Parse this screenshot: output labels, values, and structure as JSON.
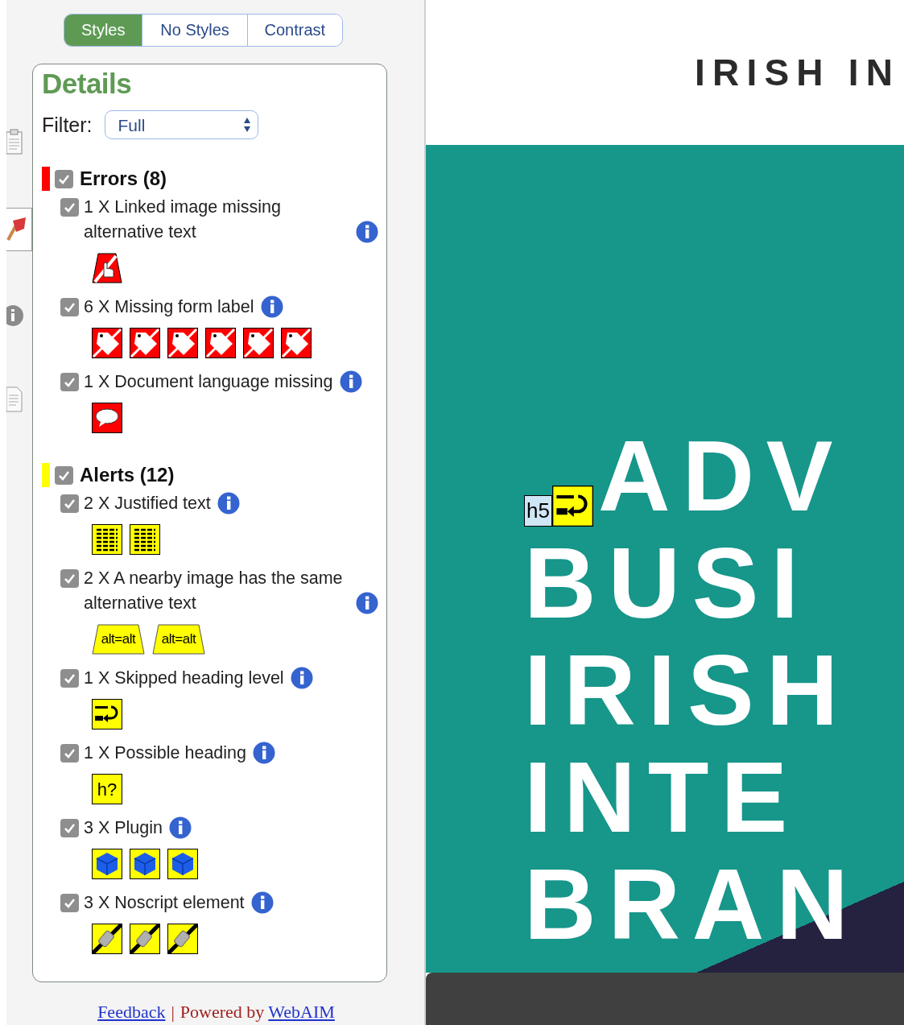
{
  "view_tabs": [
    {
      "label": "Styles",
      "selected": true
    },
    {
      "label": "No Styles",
      "selected": false
    },
    {
      "label": "Contrast",
      "selected": false
    }
  ],
  "details": {
    "title": "Details",
    "filter_label": "Filter:",
    "filter_value": "Full"
  },
  "groups": [
    {
      "title": "Errors (8)",
      "color": "#ff0000",
      "checked": true,
      "items": [
        {
          "text": "1 X Linked image missing alternative text",
          "checked": true,
          "icons": [
            {
              "kind": "linked_image"
            }
          ]
        },
        {
          "text": "6 X Missing form label",
          "checked": true,
          "icons": [
            {
              "kind": "form_label"
            },
            {
              "kind": "form_label"
            },
            {
              "kind": "form_label"
            },
            {
              "kind": "form_label"
            },
            {
              "kind": "form_label"
            },
            {
              "kind": "form_label"
            }
          ]
        },
        {
          "text": "1 X Document language missing",
          "checked": true,
          "icons": [
            {
              "kind": "language"
            }
          ]
        }
      ]
    },
    {
      "title": "Alerts (12)",
      "color": "#ffff00",
      "checked": true,
      "items": [
        {
          "text": "2 X Justified text",
          "checked": true,
          "icons": [
            {
              "kind": "justified"
            },
            {
              "kind": "justified"
            }
          ]
        },
        {
          "text": "2 X A nearby image has the same alternative text",
          "checked": true,
          "icons": [
            {
              "kind": "alt",
              "label": "alt=alt"
            },
            {
              "kind": "alt",
              "label": "alt=alt"
            }
          ]
        },
        {
          "text": "1 X Skipped heading level",
          "checked": true,
          "icons": [
            {
              "kind": "skipped_heading"
            }
          ]
        },
        {
          "text": "1 X Possible heading",
          "checked": true,
          "icons": [
            {
              "kind": "possible_heading",
              "label": "h?"
            }
          ]
        },
        {
          "text": "3 X Plugin",
          "checked": true,
          "icons": [
            {
              "kind": "plugin"
            },
            {
              "kind": "plugin"
            },
            {
              "kind": "plugin"
            }
          ]
        },
        {
          "text": "3 X Noscript element",
          "checked": true,
          "icons": [
            {
              "kind": "noscript"
            },
            {
              "kind": "noscript"
            },
            {
              "kind": "noscript"
            }
          ]
        }
      ]
    }
  ],
  "footer": {
    "feedback": "Feedback",
    "separator": "|",
    "powered_by": "Powered by",
    "webaim": "WebAIM"
  },
  "page": {
    "header": "IRISH IN",
    "heading_marker": "h5",
    "headline": [
      "ADV",
      "BUSI",
      "IRISH",
      "INTE",
      "BRAN"
    ]
  }
}
